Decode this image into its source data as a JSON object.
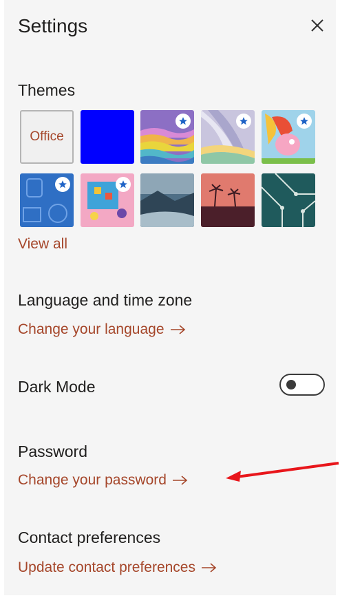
{
  "panel": {
    "title": "Settings"
  },
  "themes": {
    "heading": "Themes",
    "tiles": [
      {
        "name": "Office",
        "label": "Office",
        "premium": false
      },
      {
        "name": "Blue",
        "premium": false
      },
      {
        "name": "Rainbow waves",
        "premium": true
      },
      {
        "name": "Silver ribbons",
        "premium": true
      },
      {
        "name": "Cartoon character",
        "premium": true
      },
      {
        "name": "Blue sports",
        "premium": true
      },
      {
        "name": "Board game",
        "premium": true
      },
      {
        "name": "Mountains",
        "premium": false
      },
      {
        "name": "Palm sunset",
        "premium": false
      },
      {
        "name": "Circuit",
        "premium": false
      }
    ],
    "view_all": "View all"
  },
  "language": {
    "heading": "Language and time zone",
    "link": "Change your language"
  },
  "dark_mode": {
    "heading": "Dark Mode",
    "enabled": false
  },
  "password": {
    "heading": "Password",
    "link": "Change your password"
  },
  "contact": {
    "heading": "Contact preferences",
    "link": "Update contact preferences"
  },
  "colors": {
    "link": "#a5462a",
    "annotation_arrow": "#e8161b"
  },
  "icons": {
    "close": "close-icon",
    "link_arrow": "arrow-right-icon",
    "premium": "star-icon"
  }
}
